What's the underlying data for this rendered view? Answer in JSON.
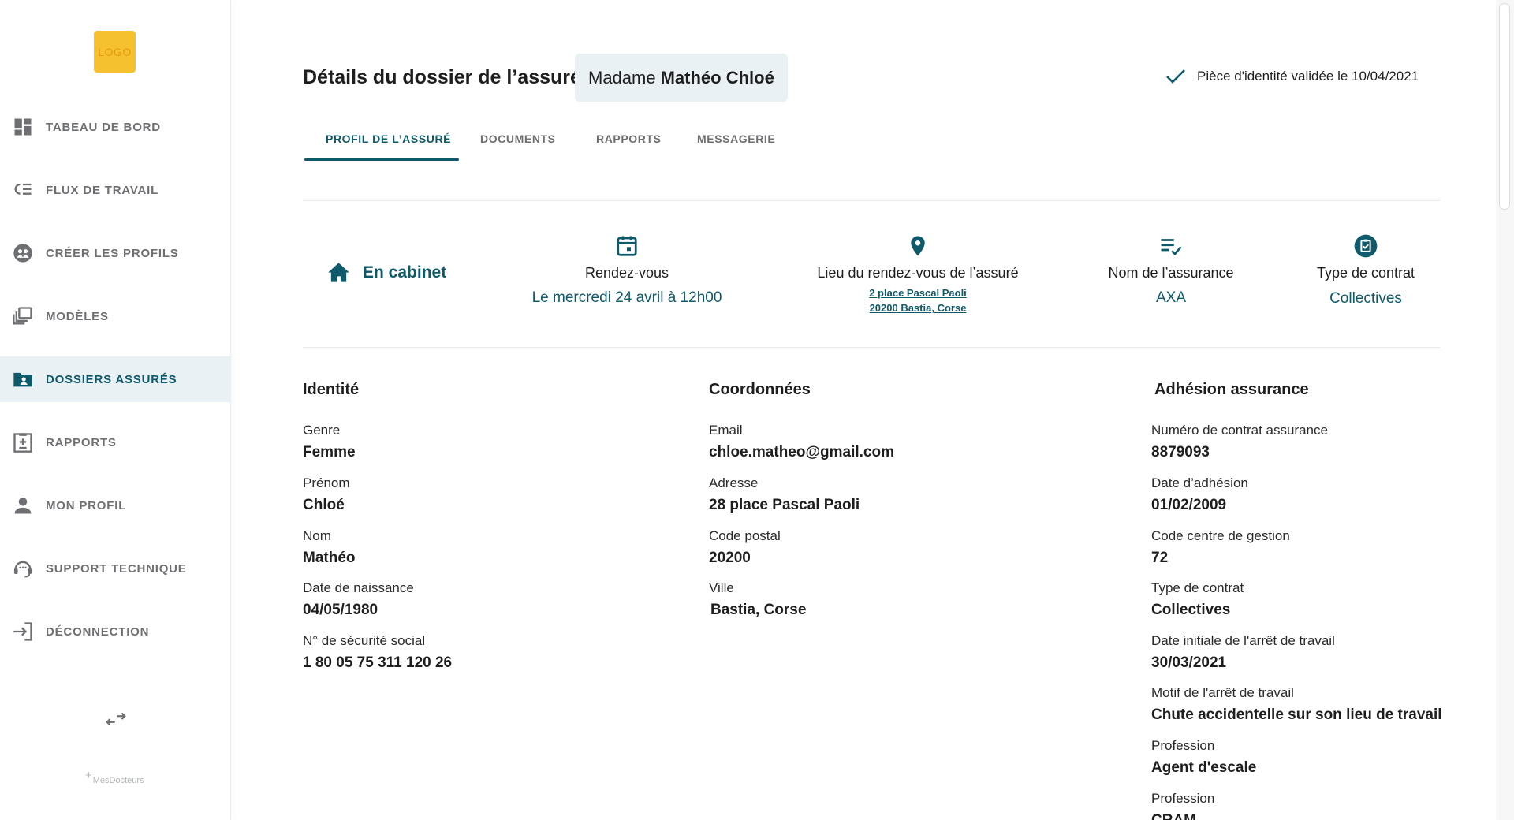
{
  "sidebar": {
    "logo": "LOGO",
    "items": [
      {
        "label": "TABEAU DE BORD",
        "icon": "dashboard-icon"
      },
      {
        "label": "FLUX DE TRAVAIL",
        "icon": "workflow-icon"
      },
      {
        "label": "CRÉER LES PROFILS",
        "icon": "create-profiles-icon"
      },
      {
        "label": "MODÈLES",
        "icon": "templates-icon"
      },
      {
        "label": "DOSSIERS ASSURÉS",
        "icon": "folder-user-icon",
        "active": true
      },
      {
        "label": "RAPPORTS",
        "icon": "report-icon"
      },
      {
        "label": "MON PROFIL",
        "icon": "user-icon"
      },
      {
        "label": "SUPPORT TECHNIQUE",
        "icon": "support-icon"
      },
      {
        "label": "DÉCONNECTION",
        "icon": "logout-icon"
      }
    ],
    "brand": "MesDocteurs"
  },
  "header": {
    "title": "Détails du dossier de l’assuré",
    "name_prefix": "Madame",
    "name": "Mathéo Chloé",
    "id_status": "Pièce d'identité validée le 10/04/2021"
  },
  "tabs": [
    {
      "label": "PROFIL DE L’ASSURÉ",
      "active": true
    },
    {
      "label": "DOCUMENTS"
    },
    {
      "label": "RAPPORTS"
    },
    {
      "label": "MESSAGERIE"
    }
  ],
  "summary": {
    "mode": "En cabinet",
    "rdv_label": "Rendez-vous",
    "rdv_value": "Le mercredi 24 avril à 12h00",
    "lieu_label": "Lieu du rendez-vous de l’assuré",
    "lieu_line1": "2 place Pascal Paoli",
    "lieu_line2": "20200 Bastia, Corse",
    "assurance_label": "Nom de l’assurance",
    "assurance_value": "AXA",
    "contrat_label": "Type de contrat",
    "contrat_value": "Collectives"
  },
  "identite": {
    "title": "Identité",
    "fields": [
      {
        "label": "Genre",
        "value": "Femme"
      },
      {
        "label": "Prénom",
        "value": "Chloé"
      },
      {
        "label": "Nom",
        "value": "Mathéo"
      },
      {
        "label": "Date de naissance",
        "value": "04/05/1980"
      },
      {
        "label": "N° de sécurité social",
        "value": "1 80 05 75 311 120 26"
      }
    ]
  },
  "coordonnees": {
    "title": "Coordonnées",
    "fields": [
      {
        "label": "Email",
        "value": "chloe.matheo@gmail.com"
      },
      {
        "label": "Adresse",
        "value": "28 place Pascal Paoli"
      },
      {
        "label": "Code postal",
        "value": "20200"
      },
      {
        "label": "Ville",
        "value": "Bastia, Corse"
      }
    ]
  },
  "adhesion": {
    "title": "Adhésion assurance",
    "fields": [
      {
        "label": "Numéro de contrat assurance",
        "value": "8879093"
      },
      {
        "label": "Date d’adhésion",
        "value": "01/02/2009"
      },
      {
        "label": "Code centre de gestion",
        "value": "72"
      },
      {
        "label": "Type de contrat",
        "value": "Collectives"
      },
      {
        "label": "Date initiale de l'arrêt de travail",
        "value": "30/03/2021"
      },
      {
        "label": "Motif de l'arrêt de travail",
        "value": "Chute accidentelle sur son lieu de travail"
      },
      {
        "label": "Profession",
        "value": "Agent d'escale"
      },
      {
        "label": "Profession",
        "value": "CRAM"
      }
    ]
  },
  "colors": {
    "accent": "#0f5a6a",
    "active_bg": "#e9f1f4",
    "logo": "#f5c12e"
  }
}
